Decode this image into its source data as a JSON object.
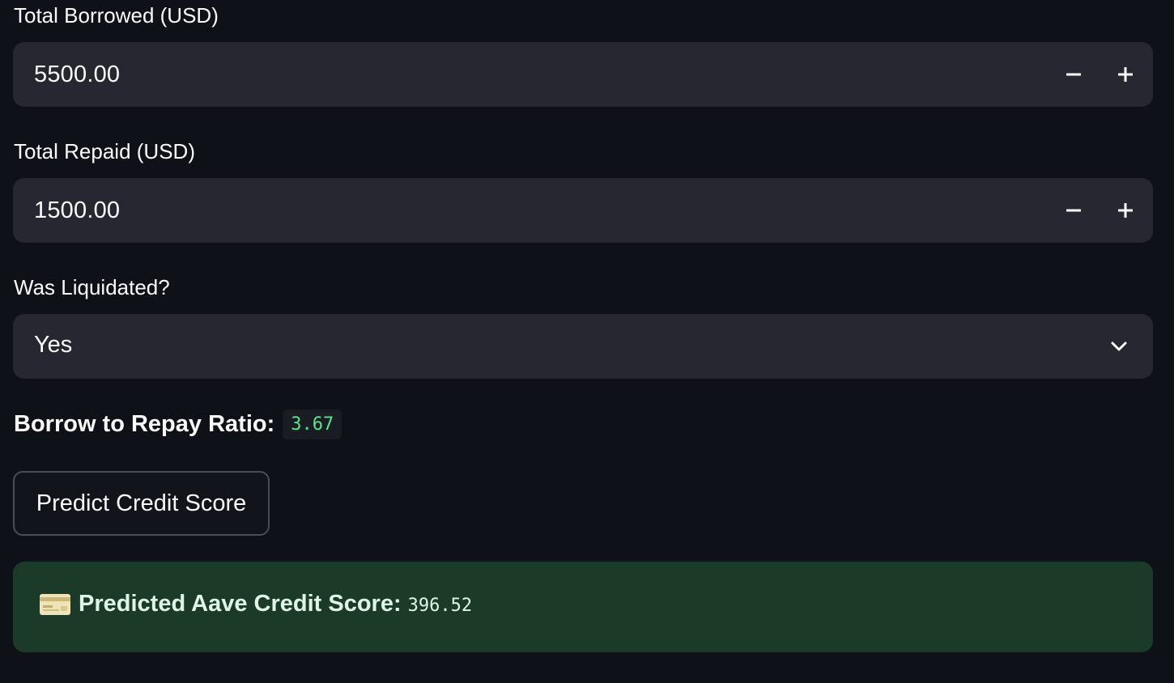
{
  "fields": {
    "borrowed": {
      "label": "Total Borrowed (USD)",
      "value": "5500.00"
    },
    "repaid": {
      "label": "Total Repaid (USD)",
      "value": "1500.00"
    },
    "liquidated": {
      "label": "Was Liquidated?",
      "selected": "Yes"
    }
  },
  "ratio": {
    "label": "Borrow to Repay Ratio:",
    "value": "3.67"
  },
  "predict_button": {
    "label": "Predict Credit Score"
  },
  "result": {
    "icon": "credit-card-icon",
    "label": "Predicted Aave Credit Score:",
    "value": "396.52"
  },
  "colors": {
    "background": "#0e1117",
    "input_background": "#262730",
    "success_background": "#1b3b28",
    "code_green": "#5ce488"
  }
}
